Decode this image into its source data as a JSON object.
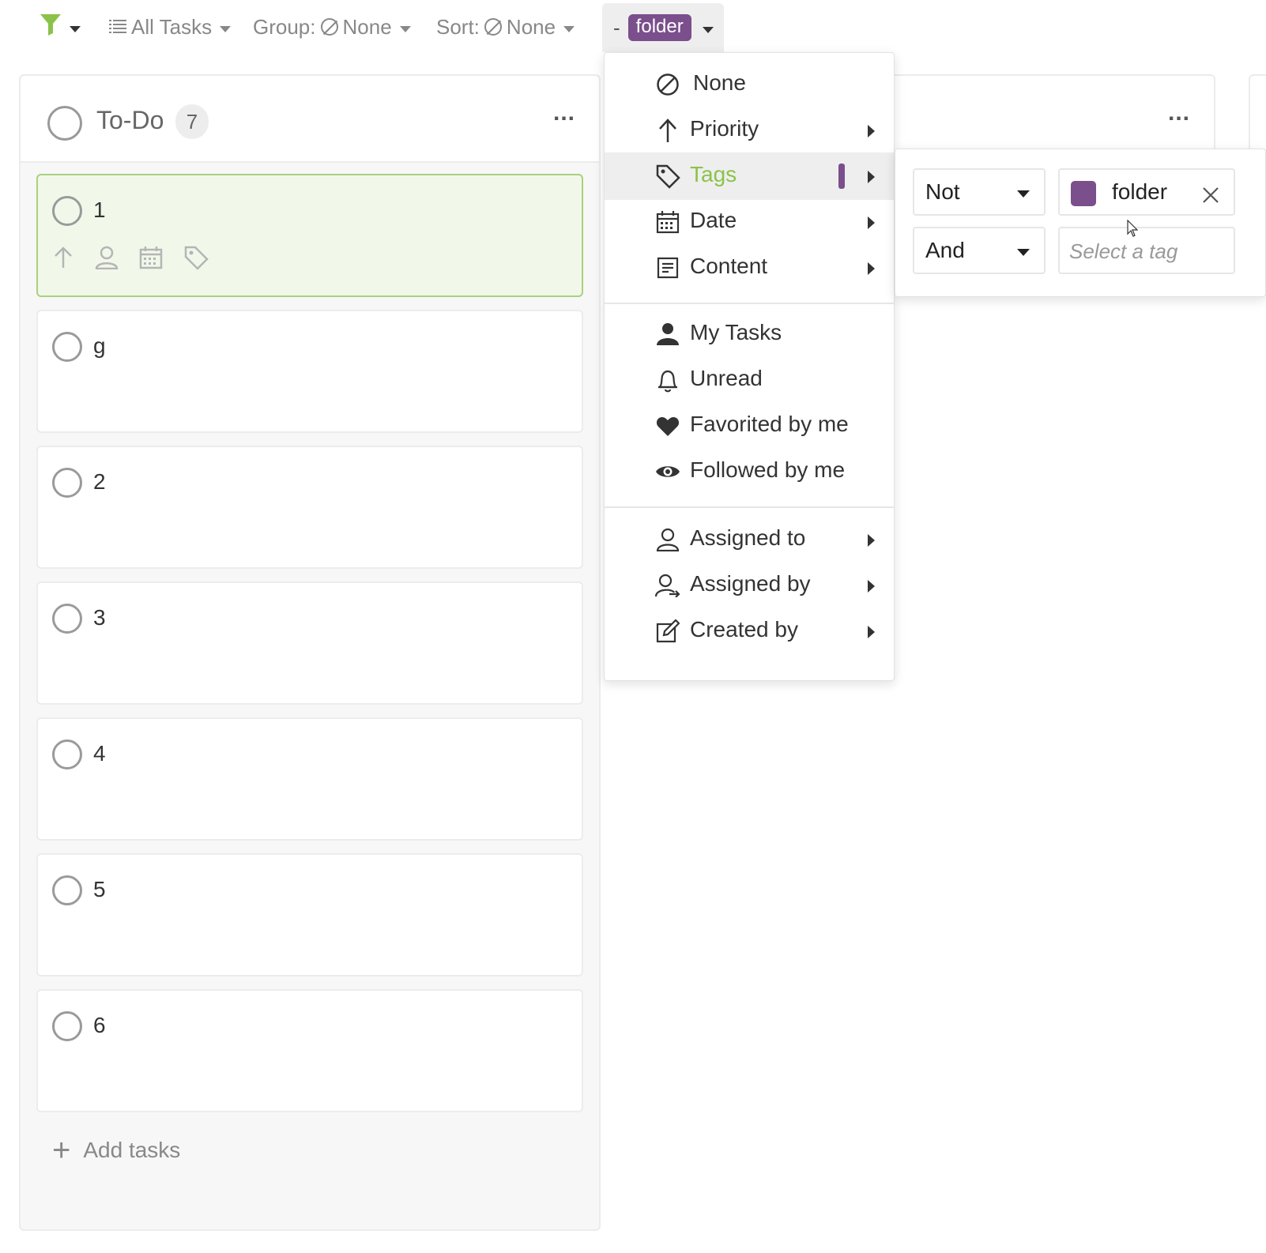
{
  "toolbar": {
    "list_label": "All Tasks",
    "group_label": "Group:",
    "group_value": "None",
    "sort_label": "Sort:",
    "sort_value": "None",
    "active_filter_prefix": "-",
    "active_filter_tag": "folder"
  },
  "column": {
    "title": "To-Do",
    "count": "7",
    "more": "...",
    "cards": [
      {
        "title": "1"
      },
      {
        "title": "g"
      },
      {
        "title": "2"
      },
      {
        "title": "3"
      },
      {
        "title": "4"
      },
      {
        "title": "5"
      },
      {
        "title": "6"
      }
    ],
    "add_label": "Add tasks"
  },
  "column2": {
    "more": "..."
  },
  "filter_menu": {
    "items": [
      {
        "label": "None",
        "icon": "none-icon"
      },
      {
        "label": "Priority",
        "icon": "arrow-up-icon"
      },
      {
        "label": "Tags",
        "icon": "tag-icon"
      },
      {
        "label": "Date",
        "icon": "calendar-icon"
      },
      {
        "label": "Content",
        "icon": "content-icon"
      },
      {
        "label": "My Tasks",
        "icon": "user-icon"
      },
      {
        "label": "Unread",
        "icon": "bell-icon"
      },
      {
        "label": "Favorited by me",
        "icon": "heart-icon"
      },
      {
        "label": "Followed by me",
        "icon": "eye-icon"
      },
      {
        "label": "Assigned to",
        "icon": "user-outline-icon"
      },
      {
        "label": "Assigned by",
        "icon": "user-arrow-icon"
      },
      {
        "label": "Created by",
        "icon": "edit-icon"
      }
    ],
    "active_item": "Tags"
  },
  "tag_submenu": {
    "operator_1": "Not",
    "tag_1": "folder",
    "operator_2": "And",
    "tag_placeholder": "Select a tag"
  },
  "colors": {
    "accent_green": "#8bc34a",
    "tag_purple": "#7a4f8c",
    "active_card_bg": "#f1f8ea"
  }
}
